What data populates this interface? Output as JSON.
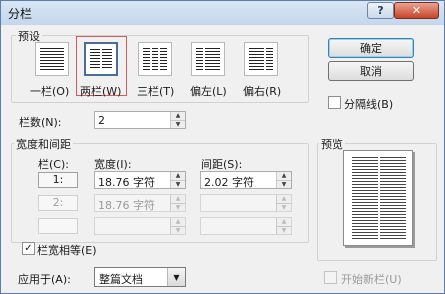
{
  "title": "分栏",
  "title_buttons": {
    "help": "?",
    "close": "✕"
  },
  "presets": {
    "group_label": "预设",
    "items": [
      {
        "label": "一栏(O)",
        "columns": 1
      },
      {
        "label": "两栏(W)",
        "columns": 2,
        "selected": true
      },
      {
        "label": "三栏(T)",
        "columns": 3
      },
      {
        "label": "偏左(L)",
        "columns": 2
      },
      {
        "label": "偏右(R)",
        "columns": 2
      }
    ]
  },
  "buttons": {
    "ok": "确定",
    "cancel": "取消"
  },
  "separator": {
    "label": "分隔线(B)",
    "checked": false
  },
  "num_columns": {
    "label": "栏数(N):",
    "value": "2"
  },
  "width_spacing": {
    "group_label": "宽度和间距",
    "headers": {
      "col": "栏(C):",
      "width": "宽度(I):",
      "spacing": "间距(S):"
    },
    "rows": [
      {
        "num": "1:",
        "width": "18.76 字符",
        "spacing": "2.02 字符",
        "enabled": true
      },
      {
        "num": "2:",
        "width": "18.76 字符",
        "spacing": "",
        "enabled": false
      },
      {
        "num": "",
        "width": "",
        "spacing": "",
        "enabled": false
      }
    ]
  },
  "equal_width": {
    "label": "栏宽相等(E)",
    "checked": true
  },
  "preview": {
    "label": "预览"
  },
  "apply_to": {
    "label": "应用于(A):",
    "value": "整篇文档"
  },
  "start_new_column": {
    "label": "开始新栏(U)",
    "checked": false
  },
  "icons": {
    "check": "✓",
    "spin_up": "▲",
    "spin_down": "▼",
    "dropdown": "▼"
  }
}
